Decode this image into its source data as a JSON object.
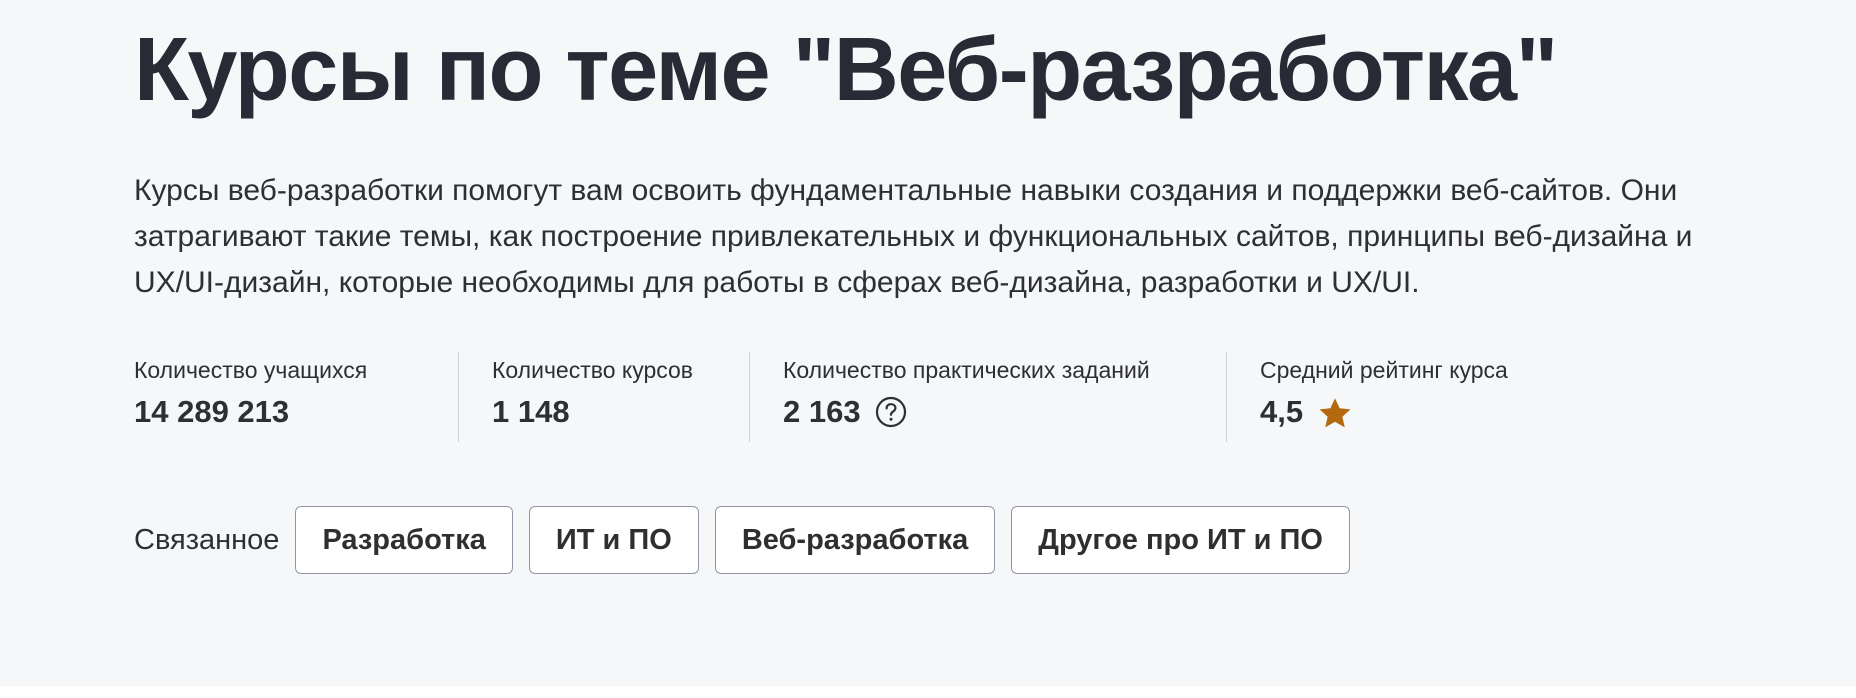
{
  "header": {
    "title": "Курсы по теме \"Веб-разработка\""
  },
  "description": "Курсы веб-разработки помогут вам освоить фундаментальные навыки создания и поддержки веб-сайтов. Они затрагивают такие темы, как построение привлекательных и функциональных сайтов, принципы веб-дизайна и UX/UI-дизайн, которые необходимы для работы в сферах веб-дизайна, разработки и UX/UI.",
  "stats": [
    {
      "label": "Количество учащихся",
      "value": "14 289 213"
    },
    {
      "label": "Количество курсов",
      "value": "1 148"
    },
    {
      "label": "Количество практических заданий",
      "value": "2 163",
      "icon": "question-circle-icon"
    },
    {
      "label": "Средний рейтинг курса",
      "value": "4,5",
      "icon": "star-icon"
    }
  ],
  "related": {
    "label": "Связанное",
    "chips": [
      "Разработка",
      "ИТ и ПО",
      "Веб-разработка",
      "Другое про ИТ и ПО"
    ]
  },
  "colors": {
    "background": "#f6f7f9",
    "title": "#282a36",
    "text": "#2d2f31",
    "star": "#b4690e",
    "chip_border": "#9194ac",
    "divider": "#d1d2e0"
  }
}
